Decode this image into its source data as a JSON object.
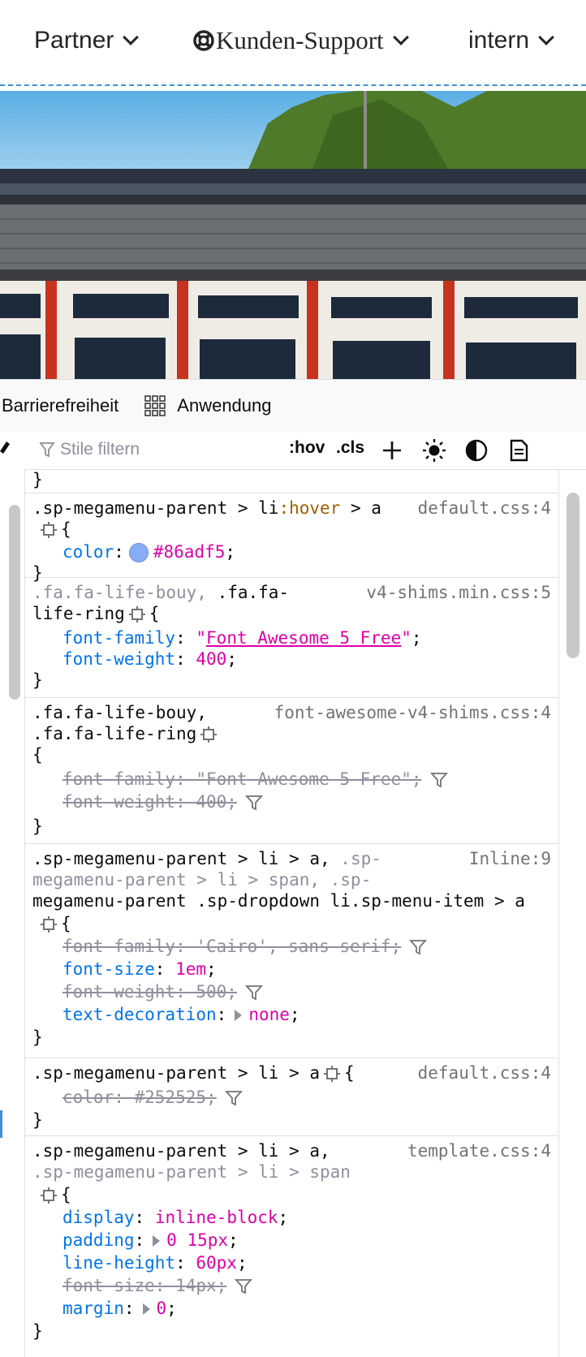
{
  "nav": {
    "partner": "Partner",
    "support": "Kunden-Support",
    "intern": "intern"
  },
  "devtools": {
    "tabs": [
      "Barrierefreiheit",
      "Anwendung"
    ],
    "filter_placeholder": "Stile filtern",
    "hov": ":hov",
    "cls": ".cls",
    "rules": [
      {
        "closing_brace": "}"
      },
      {
        "selector_a": ".sp-megamenu-parent > li",
        "selector_pseudo": ":hover",
        "selector_b": " > a",
        "source": "default.css:4",
        "brace_open": "{",
        "p1_name": "color",
        "p1_value": "#86adf5",
        "swatch_color": "#86adf5",
        "brace_close": "}"
      },
      {
        "sel_l1_dim": ".fa.fa-life-bouy, ",
        "sel_l1": ".fa.fa-",
        "sel_l2": "life-ring",
        "source": "v4-shims.min.css:5",
        "brace_open": "{",
        "p1_name": "font-family",
        "p1_value_q1": "\"",
        "p1_value_link": "Font Awesome 5 Free",
        "p1_value_q2": "\"",
        "p2_name": "font-weight",
        "p2_value": "400",
        "brace_close": "}"
      },
      {
        "sel_l1_dim": ".fa.fa-life-bouy,",
        "sel_l2": ".fa.fa-life-ring",
        "source": "font-awesome-v4-shims.css:4",
        "brace_open": "{",
        "p1": "font-family: \"Font Awesome 5 Free\";",
        "p2": "font-weight: 400;",
        "brace_close": "}"
      },
      {
        "sel_l1": ".sp-megamenu-parent > li > a,",
        "sel_l1_dim": " .sp-",
        "sel_l2_dim": "megamenu-parent > li > span, .sp-",
        "sel_l3": "megamenu-parent .sp-dropdown li.sp-menu-item > a",
        "source": "Inline:9",
        "brace_open": "{",
        "p1": "font-family: 'Cairo', sans-serif;",
        "p2_name": "font-size",
        "p2_value": "1em",
        "p3": "font-weight: 500;",
        "p4_name": "text-decoration",
        "p4_value": "none",
        "brace_close": "}"
      },
      {
        "selector": ".sp-megamenu-parent > li > a",
        "source": "default.css:4",
        "brace_open": "{",
        "p1": "color: #252525;",
        "brace_close": "}"
      },
      {
        "sel_l1": ".sp-megamenu-parent > li > a,",
        "sel_l2_dim": ".sp-megamenu-parent > li > span",
        "source": "template.css:4",
        "brace_open": "{",
        "p1_name": "display",
        "p1_value": "inline-block",
        "p2_name": "padding",
        "p2_value": "0 15px",
        "p3_name": "line-height",
        "p3_value": "60px",
        "p4": "font-size: 14px;",
        "p5_name": "margin",
        "p5_value": "0",
        "brace_close": "}"
      }
    ]
  }
}
